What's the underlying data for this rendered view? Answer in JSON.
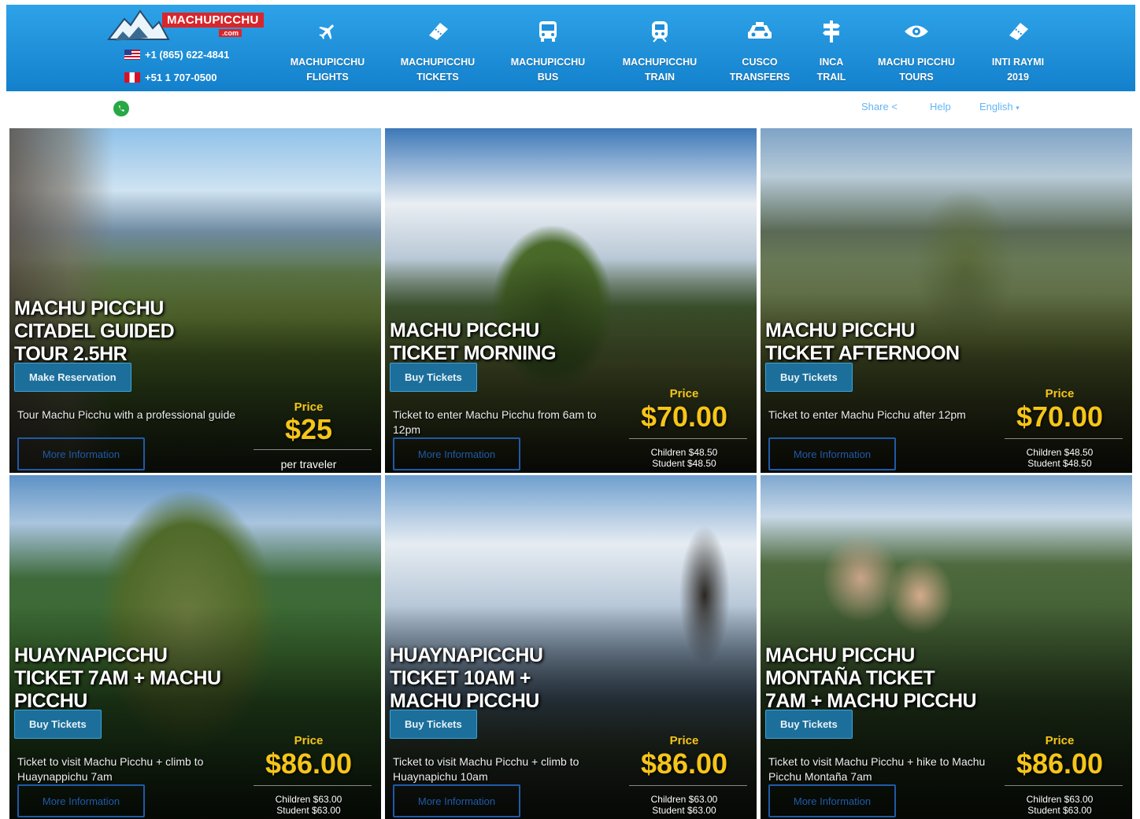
{
  "header": {
    "logo_text": "MACHUPICCHU",
    "logo_suffix": ".com",
    "phone_us": "+1 (865) 622-4841",
    "phone_pe": "+51 1 707-0500",
    "nav": [
      {
        "label": "MACHUPICCHU\nFLIGHTS",
        "icon": "plane-icon"
      },
      {
        "label": "MACHUPICCHU\nTICKETS",
        "icon": "ticket-icon"
      },
      {
        "label": "MACHUPICCHU\nBUS",
        "icon": "bus-icon"
      },
      {
        "label": "MACHUPICCHU\nTRAIN",
        "icon": "train-icon"
      },
      {
        "label": "CUSCO\nTRANSFERS",
        "icon": "car-icon"
      },
      {
        "label": "INCA\nTRAIL",
        "icon": "signpost-icon"
      },
      {
        "label": "MACHU PICCHU\nTOURS",
        "icon": "eye-icon"
      },
      {
        "label": "INTI RAYMI\n2019",
        "icon": "ticket-icon"
      }
    ]
  },
  "subbar": {
    "share": "Share",
    "help": "Help",
    "language": "English"
  },
  "cards": [
    {
      "title": "MACHU PICCHU\nCITADEL GUIDED\nTOUR 2.5HR",
      "button": "Make Reservation",
      "desc": "Tour Machu Picchu with a professional guide",
      "more": "More Information",
      "price_label": "Price",
      "price": "$25",
      "sub1": "per traveler",
      "sub2": ""
    },
    {
      "title": "MACHU PICCHU\nTICKET MORNING",
      "button": "Buy Tickets",
      "desc": "Ticket to enter Machu Picchu from 6am to 12pm",
      "more": "More Information",
      "price_label": "Price",
      "price": "$70.00",
      "sub1": "Children $48.50",
      "sub2": "Student $48.50"
    },
    {
      "title": "MACHU PICCHU\nTICKET AFTERNOON",
      "button": "Buy Tickets",
      "desc": "Ticket to enter Machu Picchu after 12pm",
      "more": "More Information",
      "price_label": "Price",
      "price": "$70.00",
      "sub1": "Children $48.50",
      "sub2": "Student $48.50"
    },
    {
      "title": "HUAYNAPICCHU\nTICKET 7AM + MACHU\nPICCHU",
      "button": "Buy Tickets",
      "desc": "Ticket to visit Machu Picchu + climb to Huaynappichu 7am",
      "more": "More Information",
      "price_label": "Price",
      "price": "$86.00",
      "sub1": "Children $63.00",
      "sub2": "Student $63.00"
    },
    {
      "title": "HUAYNAPICCHU\nTICKET 10AM +\nMACHU PICCHU",
      "button": "Buy Tickets",
      "desc": "Ticket to visit Machu Picchu + climb to Huaynapichu 10am",
      "more": "More Information",
      "price_label": "Price",
      "price": "$86.00",
      "sub1": "Children $63.00",
      "sub2": "Student $63.00"
    },
    {
      "title": "MACHU PICCHU\nMONTAÑA TICKET\n7AM + MACHU PICCHU",
      "button": "Buy Tickets",
      "desc": "Ticket to visit Machu Picchu + hike to Machu Picchu Montaña 7am",
      "more": "More Information",
      "price_label": "Price",
      "price": "$86.00",
      "sub1": "Children $63.00",
      "sub2": "Student $63.00"
    }
  ]
}
